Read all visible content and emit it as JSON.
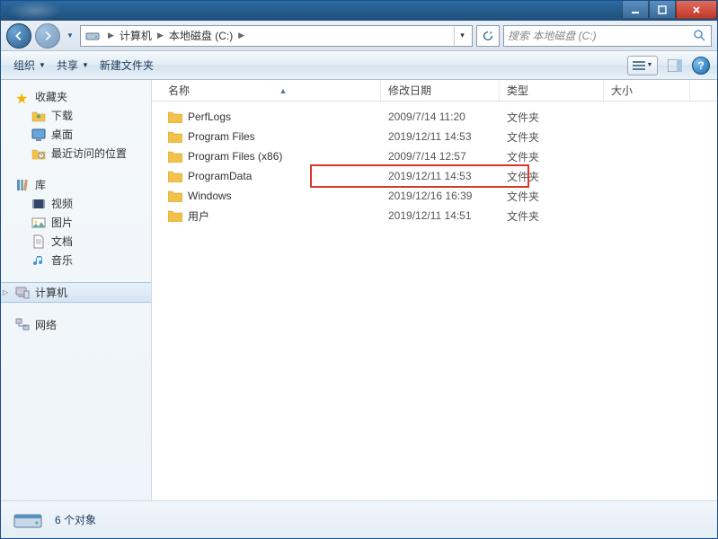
{
  "breadcrumb": {
    "root_icon": "drive-icon",
    "items": [
      "计算机",
      "本地磁盘 (C:)"
    ]
  },
  "search": {
    "placeholder": "搜索 本地磁盘 (C:)"
  },
  "toolbar": {
    "organize": "组织",
    "share": "共享",
    "new_folder": "新建文件夹"
  },
  "columns": {
    "name": "名称",
    "date": "修改日期",
    "type": "类型",
    "size": "大小"
  },
  "sidebar": {
    "favorites": {
      "label": "收藏夹",
      "items": [
        {
          "icon": "download-icon",
          "label": "下载"
        },
        {
          "icon": "desktop-icon",
          "label": "桌面"
        },
        {
          "icon": "recent-icon",
          "label": "最近访问的位置"
        }
      ]
    },
    "libraries": {
      "label": "库",
      "items": [
        {
          "icon": "video-icon",
          "label": "视频"
        },
        {
          "icon": "pictures-icon",
          "label": "图片"
        },
        {
          "icon": "documents-icon",
          "label": "文档"
        },
        {
          "icon": "music-icon",
          "label": "音乐"
        }
      ]
    },
    "computer": {
      "label": "计算机"
    },
    "network": {
      "label": "网络"
    }
  },
  "files": [
    {
      "name": "PerfLogs",
      "date": "2009/7/14 11:20",
      "type": "文件夹",
      "highlight": false
    },
    {
      "name": "Program Files",
      "date": "2019/12/11 14:53",
      "type": "文件夹",
      "highlight": false
    },
    {
      "name": "Program Files (x86)",
      "date": "2009/7/14 12:57",
      "type": "文件夹",
      "highlight": false
    },
    {
      "name": "ProgramData",
      "date": "2019/12/11 14:53",
      "type": "文件夹",
      "highlight": true
    },
    {
      "name": "Windows",
      "date": "2019/12/16 16:39",
      "type": "文件夹",
      "highlight": false
    },
    {
      "name": "用户",
      "date": "2019/12/11 14:51",
      "type": "文件夹",
      "highlight": false
    }
  ],
  "status": {
    "text": "6 个对象"
  }
}
